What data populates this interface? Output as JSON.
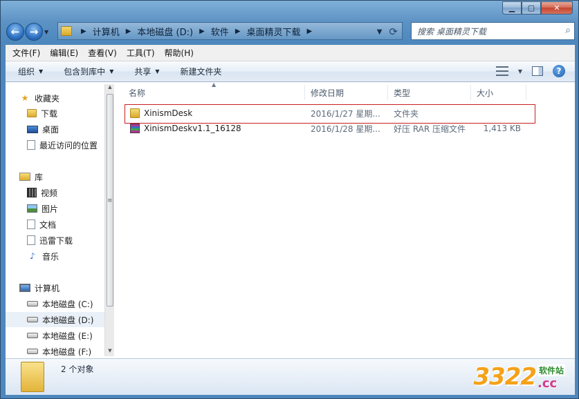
{
  "window": {
    "caption_buttons": {
      "minimize": "▁",
      "maximize": "▢",
      "close": "✕"
    }
  },
  "nav": {
    "back_icon": "back-arrow",
    "forward_icon": "forward-arrow",
    "breadcrumb": [
      "计算机",
      "本地磁盘 (D:)",
      "软件",
      "桌面精灵下载"
    ],
    "search_placeholder": "搜索 桌面精灵下载"
  },
  "menubar": [
    "文件(F)",
    "编辑(E)",
    "查看(V)",
    "工具(T)",
    "帮助(H)"
  ],
  "toolbar": {
    "organize": "组织",
    "include_library": "包含到库中",
    "share": "共享",
    "new_folder": "新建文件夹"
  },
  "sidebar": {
    "favorites": {
      "label": "收藏夹",
      "items": [
        "下载",
        "桌面",
        "最近访问的位置"
      ]
    },
    "libraries": {
      "label": "库",
      "items": [
        "视频",
        "图片",
        "文档",
        "迅雷下载",
        "音乐"
      ]
    },
    "computer": {
      "label": "计算机",
      "items": [
        "本地磁盘 (C:)",
        "本地磁盘 (D:)",
        "本地磁盘 (E:)",
        "本地磁盘 (F:)"
      ]
    },
    "selected": "本地磁盘 (D:)"
  },
  "columns": {
    "name": "名称",
    "date": "修改日期",
    "type": "类型",
    "size": "大小"
  },
  "files": [
    {
      "name": "XinismDesk",
      "date": "2016/1/27 星期...",
      "type": "文件夹",
      "size": "",
      "icon": "folder-icon"
    },
    {
      "name": "XinismDeskv1.1_16128",
      "date": "2016/1/28 星期...",
      "type": "好压 RAR 压缩文件",
      "size": "1,413 KB",
      "icon": "rar-archive-icon"
    }
  ],
  "details": {
    "summary": "2 个对象"
  },
  "watermark": {
    "number": "3322",
    "cn": "软件站",
    "domain": ".cc"
  },
  "colors": {
    "highlight_border": "#c81e1e",
    "title_gradient_top": "#7fb0d8",
    "title_gradient_bottom": "#4d87bd"
  }
}
